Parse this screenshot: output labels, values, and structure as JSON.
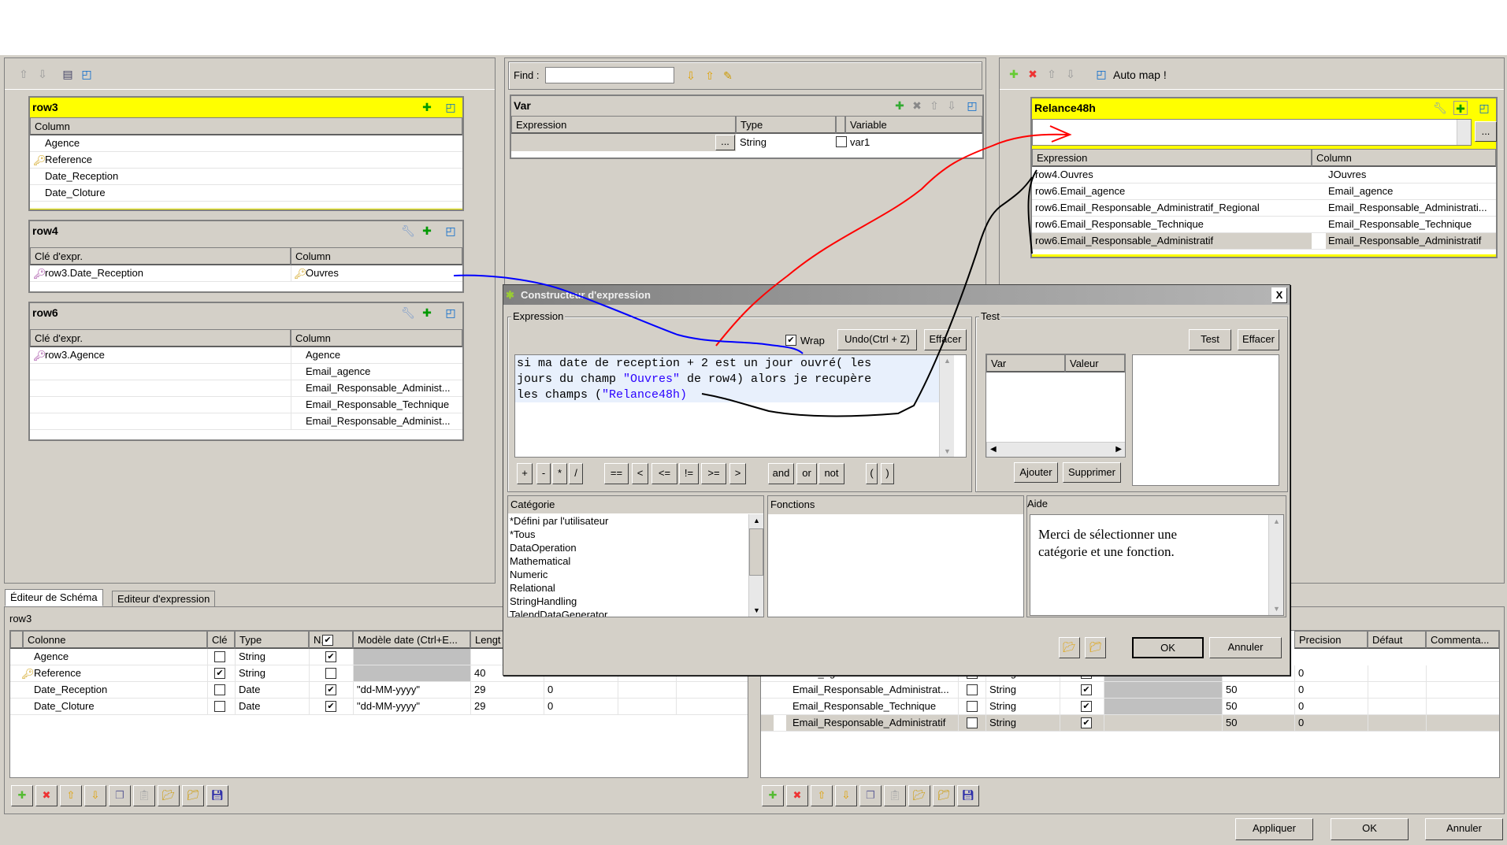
{
  "colors": {
    "highlight_yellow": "#ffff00",
    "selection_gray": "#d4d0c8",
    "annotation_red": "#ff0000",
    "annotation_blue": "#0000ff",
    "annotation_black": "#000000",
    "string_literal": "#2a00ff"
  },
  "left": {
    "toolbar": [
      "arrow-up-icon",
      "arrow-down-icon",
      "table-icon",
      "minimize-icon"
    ],
    "row3": {
      "title": "row3",
      "header": "Column",
      "rows": [
        {
          "name": "Agence",
          "key": false
        },
        {
          "name": "Reference",
          "key": true
        },
        {
          "name": "Date_Reception",
          "key": false
        },
        {
          "name": "Date_Cloture",
          "key": false
        }
      ]
    },
    "row4": {
      "title": "row4",
      "headers": [
        "Clé d'expr.",
        "Column"
      ],
      "rows": [
        {
          "expr": "row3.Date_Reception",
          "col": "Ouvres",
          "key": true
        }
      ]
    },
    "row6": {
      "title": "row6",
      "headers": [
        "Clé d'expr.",
        "Column"
      ],
      "rows": [
        {
          "expr": "row3.Agence",
          "col": "Agence"
        },
        {
          "expr": "",
          "col": "Email_agence"
        },
        {
          "expr": "",
          "col": "Email_Responsable_Administ..."
        },
        {
          "expr": "",
          "col": "Email_Responsable_Technique"
        },
        {
          "expr": "",
          "col": "Email_Responsable_Administ..."
        }
      ]
    }
  },
  "middle": {
    "find_label": "Find :",
    "find_value": "",
    "var": {
      "title": "Var",
      "headers": [
        "Expression",
        "Type",
        "",
        "Variable"
      ],
      "row": {
        "expr_btn": "...",
        "type": "String",
        "variable": "var1"
      }
    }
  },
  "right": {
    "automap_label": "Auto map !",
    "output": {
      "title": "Relance48h",
      "expr_btn": "...",
      "headers": [
        "Expression",
        "Column"
      ],
      "rows": [
        {
          "expr": "row4.Ouvres",
          "col": "JOuvres"
        },
        {
          "expr": "row6.Email_agence",
          "col": "Email_agence"
        },
        {
          "expr": "row6.Email_Responsable_Administratif_Regional",
          "col": "Email_Responsable_Administrati..."
        },
        {
          "expr": "row6.Email_Responsable_Technique",
          "col": "Email_Responsable_Technique"
        },
        {
          "expr": "row6.Email_Responsable_Administratif",
          "col": "Email_Responsable_Administratif",
          "selected": true
        }
      ]
    }
  },
  "dialog": {
    "title": "Constructeur d'expression",
    "close": "X",
    "expression_label": "Expression",
    "wrap_label": "Wrap",
    "wrap_checked": true,
    "undo_label": "Undo(Ctrl + Z)",
    "clear_label": "Effacer",
    "expression_lines": [
      [
        {
          "t": "si ma date de reception + 2 est un jour ouvré( les"
        }
      ],
      [
        {
          "t": "jours du champ "
        },
        {
          "t": "\"Ouvres\"",
          "s": true
        },
        {
          "t": " de row4) alors je recupère"
        }
      ],
      [
        {
          "t": "les champs ("
        },
        {
          "t": "\"Relance48h)",
          "s": true
        }
      ]
    ],
    "operators": [
      "+",
      "-",
      "*",
      "/",
      "==",
      "<",
      "<=",
      "!=",
      ">=",
      ">",
      "and",
      "or",
      "not",
      "(",
      ")"
    ],
    "test_label": "Test",
    "test_btn": "Test",
    "test_clear": "Effacer",
    "test_headers": [
      "Var",
      "Valeur"
    ],
    "add_btn": "Ajouter",
    "remove_btn": "Supprimer",
    "category_label": "Catégorie",
    "categories": [
      "*Défini par l'utilisateur",
      "*Tous",
      "DataOperation",
      "Mathematical",
      "Numeric",
      "Relational",
      "StringHandling",
      "TalendDataGenerator"
    ],
    "functions_label": "Fonctions",
    "help_label": "Aide",
    "help_text": "Merci de sélectionner une catégorie et une fonction.",
    "ok": "OK",
    "cancel": "Annuler"
  },
  "bottom": {
    "tabs": [
      "Éditeur de  Schéma",
      "Editeur d'expression"
    ],
    "active_tab": 0,
    "schema_name": "row3",
    "left_headers": [
      "",
      "Colonne",
      "Clé",
      "Type",
      "N..",
      "Modèle date (Ctrl+E...",
      "Lengt"
    ],
    "left_rows": [
      {
        "name": "Agence",
        "key": false,
        "type": "String",
        "nullable": true,
        "pattern": "",
        "length": "",
        "precision": ""
      },
      {
        "name": "Reference",
        "key": true,
        "type": "String",
        "nullable": false,
        "pattern": "",
        "length": "40",
        "precision": ""
      },
      {
        "name": "Date_Reception",
        "key": false,
        "type": "Date",
        "nullable": true,
        "pattern": "\"dd-MM-yyyy\"",
        "length": "29",
        "precision": "0"
      },
      {
        "name": "Date_Cloture",
        "key": false,
        "type": "Date",
        "nullable": true,
        "pattern": "\"dd-MM-yyyy\"",
        "length": "29",
        "precision": "0"
      }
    ],
    "right_headers": [
      "Precision",
      "Défaut",
      "Commenta..."
    ],
    "right_rows": [
      {
        "name": "Email_agence",
        "key": false,
        "type": "String",
        "nullable": true,
        "length": "",
        "precision": "0"
      },
      {
        "name": "Email_Responsable_Administrat...",
        "key": false,
        "type": "String",
        "nullable": true,
        "length": "50",
        "precision": "0"
      },
      {
        "name": "Email_Responsable_Technique",
        "key": false,
        "type": "String",
        "nullable": true,
        "length": "50",
        "precision": "0"
      },
      {
        "name": "Email_Responsable_Administratif",
        "key": false,
        "type": "String",
        "nullable": true,
        "length": "50",
        "precision": "0",
        "selected": true
      }
    ],
    "toolbar": [
      "add-icon",
      "delete-icon",
      "move-up-icon",
      "move-down-icon",
      "copy-icon",
      "paste-icon",
      "import-icon",
      "export-icon",
      "save-icon"
    ],
    "apply": "Appliquer",
    "ok": "OK",
    "cancel": "Annuler"
  }
}
